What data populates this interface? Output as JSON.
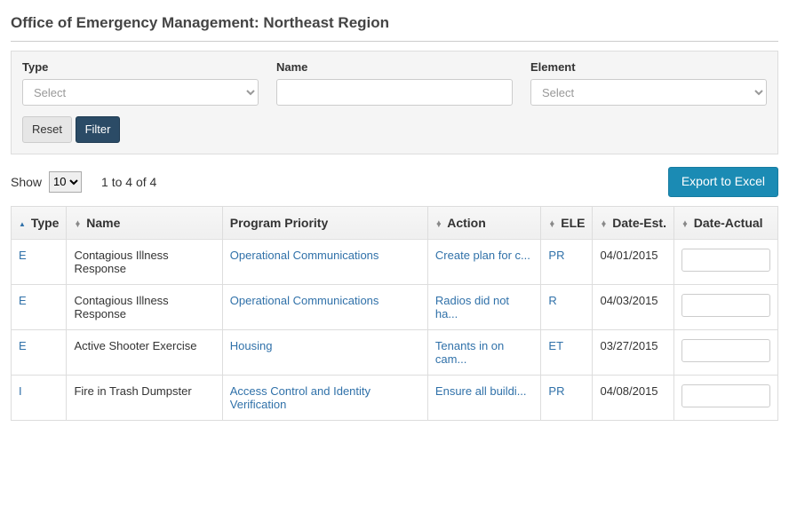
{
  "page_title": "Office of Emergency Management: Northeast Region",
  "filters": {
    "type": {
      "label": "Type",
      "placeholder": "Select"
    },
    "name": {
      "label": "Name",
      "placeholder": ""
    },
    "element": {
      "label": "Element",
      "placeholder": "Select"
    },
    "reset_label": "Reset",
    "filter_label": "Filter"
  },
  "toolbar": {
    "show_label": "Show",
    "page_size": "10",
    "range_text": "1 to 4 of 4",
    "export_label": "Export to Excel"
  },
  "table": {
    "headers": {
      "type": "Type",
      "name": "Name",
      "program_priority": "Program Priority",
      "action": "Action",
      "ele": "ELE",
      "date_est": "Date-Est.",
      "date_actual": "Date-Actual"
    },
    "rows": [
      {
        "type": "E",
        "name": "Contagious Illness Response",
        "program_priority": "Operational Communications",
        "action": "Create plan for c...",
        "ele": "PR",
        "date_est": "04/01/2015",
        "date_actual": ""
      },
      {
        "type": "E",
        "name": "Contagious Illness Response",
        "program_priority": "Operational Communications",
        "action": "Radios did not ha...",
        "ele": "R",
        "date_est": "04/03/2015",
        "date_actual": ""
      },
      {
        "type": "E",
        "name": "Active Shooter Exercise",
        "program_priority": "Housing",
        "action": "Tenants in on cam...",
        "ele": "ET",
        "date_est": "03/27/2015",
        "date_actual": ""
      },
      {
        "type": "I",
        "name": "Fire in Trash Dumpster",
        "program_priority": "Access Control and Identity Verification",
        "action": "Ensure all buildi...",
        "ele": "PR",
        "date_est": "04/08/2015",
        "date_actual": ""
      }
    ]
  }
}
